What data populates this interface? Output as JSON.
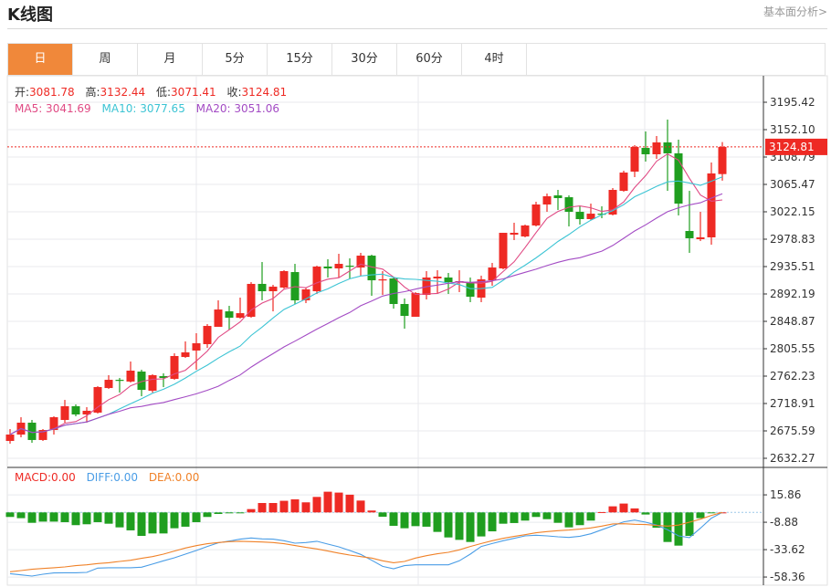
{
  "header": {
    "title": "K线图",
    "link": "基本面分析>"
  },
  "tabs": [
    {
      "label": "日",
      "active": true
    },
    {
      "label": "周"
    },
    {
      "label": "月"
    },
    {
      "label": "5分"
    },
    {
      "label": "15分"
    },
    {
      "label": "30分"
    },
    {
      "label": "60分"
    },
    {
      "label": "4时"
    }
  ],
  "legend": {
    "open_label": "开:",
    "open": "3081.78",
    "high_label": "高:",
    "high": "3132.44",
    "low_label": "低:",
    "low": "3071.41",
    "close_label": "收:",
    "close": "3124.81",
    "ma5": "MA5: 3041.69",
    "ma10": "MA10: 3077.65",
    "ma20": "MA20: 3051.06",
    "macd": "MACD:0.00",
    "diff": "DIFF:0.00",
    "dea": "DEA:0.00"
  },
  "colors": {
    "up": "#ee2a24",
    "down": "#1f9e1f",
    "ma5": "#e04a84",
    "ma10": "#3cc4d4",
    "ma20": "#a34bc4",
    "diff": "#4a9de6",
    "dea": "#f08229",
    "accent": "#f0883a"
  },
  "chart_data": [
    {
      "type": "candlestick",
      "current_price": "3124.81",
      "yaxis_ticks": [
        "3195.42",
        "3152.10",
        "3108.79",
        "3065.47",
        "3022.15",
        "2978.83",
        "2935.51",
        "2892.19",
        "2848.87",
        "2805.55",
        "2762.23",
        "2718.91",
        "2675.59",
        "2632.27"
      ],
      "ylim": [
        2632.27,
        3195.42
      ],
      "grid": true,
      "ma_periods": [
        5,
        10,
        20
      ],
      "ohlc": [
        [
          2659.7,
          2678.5,
          2655.4,
          2669.8
        ],
        [
          2669.8,
          2697.2,
          2665.5,
          2688.6
        ],
        [
          2688.6,
          2692.9,
          2656.8,
          2661.2
        ],
        [
          2661.2,
          2678.5,
          2659.7,
          2677.0
        ],
        [
          2677.0,
          2698.7,
          2669.8,
          2697.2
        ],
        [
          2692.9,
          2724.6,
          2688.6,
          2714.6
        ],
        [
          2714.6,
          2717.5,
          2698.7,
          2701.6
        ],
        [
          2701.6,
          2713.1,
          2688.6,
          2707.4
        ],
        [
          2704.5,
          2746.3,
          2703.0,
          2744.9
        ],
        [
          2743.4,
          2763.7,
          2742.0,
          2756.4
        ],
        [
          2756.4,
          2759.3,
          2736.2,
          2755.0
        ],
        [
          2753.6,
          2785.3,
          2752.1,
          2770.9
        ],
        [
          2769.4,
          2772.3,
          2730.4,
          2740.5
        ],
        [
          2739.1,
          2765.1,
          2736.2,
          2763.7
        ],
        [
          2762.2,
          2766.6,
          2744.9,
          2759.3
        ],
        [
          2757.9,
          2798.3,
          2756.4,
          2794.0
        ],
        [
          2792.5,
          2817.1,
          2791.1,
          2799.8
        ],
        [
          2802.7,
          2830.1,
          2772.3,
          2814.2
        ],
        [
          2812.8,
          2844.5,
          2807.0,
          2841.6
        ],
        [
          2840.2,
          2882.1,
          2840.2,
          2867.6
        ],
        [
          2864.7,
          2873.4,
          2835.9,
          2854.6
        ],
        [
          2854.6,
          2886.4,
          2853.2,
          2861.8
        ],
        [
          2856.1,
          2910.9,
          2854.6,
          2908.1
        ],
        [
          2908.1,
          2942.7,
          2882.1,
          2896.5
        ],
        [
          2896.5,
          2906.6,
          2864.7,
          2903.7
        ],
        [
          2902.3,
          2929.7,
          2900.8,
          2928.3
        ],
        [
          2926.8,
          2939.8,
          2876.3,
          2882.1
        ],
        [
          2882.1,
          2902.3,
          2877.7,
          2899.4
        ],
        [
          2896.5,
          2936.9,
          2892.2,
          2935.5
        ],
        [
          2935.5,
          2947.1,
          2918.2,
          2932.6
        ],
        [
          2932.6,
          2955.7,
          2918.2,
          2939.8
        ],
        [
          2936.9,
          2948.5,
          2916.7,
          2935.5
        ],
        [
          2934.0,
          2957.2,
          2921.1,
          2952.8
        ],
        [
          2952.8,
          2954.3,
          2889.3,
          2913.8
        ],
        [
          2913.8,
          2928.3,
          2890.7,
          2915.3
        ],
        [
          2916.7,
          2919.6,
          2869.0,
          2876.3
        ],
        [
          2876.3,
          2885.0,
          2837.3,
          2857.5
        ],
        [
          2856.1,
          2895.1,
          2856.1,
          2893.6
        ],
        [
          2890.7,
          2928.3,
          2883.5,
          2918.2
        ],
        [
          2916.7,
          2929.7,
          2892.2,
          2919.6
        ],
        [
          2918.2,
          2925.4,
          2892.2,
          2910.9
        ],
        [
          2910.9,
          2929.7,
          2895.1,
          2912.4
        ],
        [
          2909.5,
          2918.2,
          2879.2,
          2887.8
        ],
        [
          2886.4,
          2921.1,
          2879.2,
          2915.3
        ],
        [
          2913.8,
          2941.3,
          2905.2,
          2934.0
        ],
        [
          2932.6,
          2988.9,
          2931.1,
          2988.9
        ],
        [
          2986.0,
          3004.8,
          2977.4,
          2988.9
        ],
        [
          2983.1,
          3001.9,
          2981.7,
          3000.5
        ],
        [
          3000.5,
          3038.0,
          2999.0,
          3033.7
        ],
        [
          3033.7,
          3051.0,
          3022.1,
          3046.7
        ],
        [
          3048.1,
          3056.8,
          3025.0,
          3043.8
        ],
        [
          3045.2,
          3048.1,
          2999.0,
          3022.1
        ],
        [
          3022.1,
          3030.8,
          3001.9,
          3010.6
        ],
        [
          3010.6,
          3035.1,
          3009.1,
          3019.2
        ],
        [
          3019.2,
          3030.8,
          3012.0,
          3017.8
        ],
        [
          3017.8,
          3059.7,
          3016.4,
          3056.8
        ],
        [
          3055.3,
          3087.1,
          3053.9,
          3084.2
        ],
        [
          3085.7,
          3127.6,
          3077.0,
          3124.7
        ],
        [
          3123.2,
          3149.2,
          3101.6,
          3113.1
        ],
        [
          3113.1,
          3142.0,
          3105.9,
          3131.9
        ],
        [
          3131.9,
          3168.0,
          3055.3,
          3114.6
        ],
        [
          3114.6,
          3136.2,
          3016.4,
          3035.1
        ],
        [
          2991.8,
          3055.3,
          2957.2,
          2980.3
        ],
        [
          2978.8,
          3022.1,
          2975.9,
          2981.7
        ],
        [
          2981.7,
          3100.1,
          2970.1,
          3082.8
        ],
        [
          3081.78,
          3132.44,
          3071.41,
          3124.81
        ]
      ]
    },
    {
      "type": "macd",
      "yaxis_ticks": [
        "15.86",
        "-8.88",
        "-33.62",
        "-58.36"
      ],
      "ylim": [
        -58.36,
        15.86
      ],
      "macd": [
        -4.1,
        -5.2,
        -9.4,
        -8.3,
        -8.3,
        -8.8,
        -11.5,
        -10.7,
        -8.8,
        -10.2,
        -13.5,
        -16.2,
        -21.2,
        -19.0,
        -19.0,
        -14.3,
        -12.9,
        -8.8,
        -4.1,
        -1.4,
        -0.5,
        -0.6,
        3.0,
        8.5,
        8.5,
        10.5,
        11.8,
        9.1,
        14.0,
        18.7,
        17.9,
        16.0,
        10.7,
        1.7,
        -3.9,
        -12.1,
        -14.3,
        -12.4,
        -12.9,
        -17.6,
        -22.6,
        -24.8,
        -26.7,
        -21.7,
        -17.1,
        -10.2,
        -9.6,
        -7.4,
        -4.1,
        -6.1,
        -9.4,
        -13.5,
        -11.5,
        -7.4,
        0.3,
        5.5,
        8.0,
        3.6,
        -1.9,
        -13.8,
        -26.7,
        -30.0,
        -21.2,
        -5.2,
        -0.5,
        0.0
      ],
      "diff": [
        -55.3,
        -56.4,
        -57.5,
        -55.8,
        -54.7,
        -54.5,
        -54.5,
        -54.2,
        -50.3,
        -50.0,
        -50.0,
        -50.0,
        -49.5,
        -46.7,
        -43.7,
        -41.0,
        -37.7,
        -34.4,
        -30.8,
        -27.5,
        -25.9,
        -24.2,
        -23.1,
        -23.9,
        -24.2,
        -25.6,
        -27.8,
        -27.2,
        -26.1,
        -28.6,
        -31.1,
        -34.4,
        -37.9,
        -43.2,
        -48.7,
        -50.9,
        -48.1,
        -47.3,
        -47.3,
        -47.3,
        -47.3,
        -43.7,
        -37.7,
        -30.8,
        -28.1,
        -25.6,
        -23.4,
        -21.2,
        -20.6,
        -21.2,
        -22.0,
        -22.6,
        -21.5,
        -19.3,
        -15.7,
        -12.1,
        -8.5,
        -6.9,
        -8.8,
        -11.5,
        -15.7,
        -21.2,
        -22.8,
        -14.3,
        -5.2,
        0.0
      ],
      "dea": [
        -53.6,
        -52.5,
        -51.4,
        -50.6,
        -50.0,
        -49.2,
        -48.1,
        -47.3,
        -46.2,
        -45.4,
        -44.3,
        -43.2,
        -41.5,
        -39.9,
        -37.7,
        -34.9,
        -32.2,
        -30.0,
        -28.3,
        -27.2,
        -26.4,
        -26.1,
        -26.4,
        -26.7,
        -27.2,
        -28.3,
        -29.9,
        -31.6,
        -33.0,
        -34.9,
        -36.8,
        -38.5,
        -39.9,
        -41.2,
        -43.7,
        -45.4,
        -44.3,
        -41.2,
        -39.1,
        -37.4,
        -36.0,
        -33.8,
        -30.8,
        -28.1,
        -25.6,
        -23.4,
        -21.7,
        -20.1,
        -18.4,
        -17.3,
        -16.5,
        -15.9,
        -15.1,
        -14.0,
        -12.4,
        -10.4,
        -10.2,
        -10.7,
        -11.0,
        -11.8,
        -12.4,
        -11.5,
        -8.8,
        -6.1,
        -2.75,
        0.0
      ]
    }
  ]
}
